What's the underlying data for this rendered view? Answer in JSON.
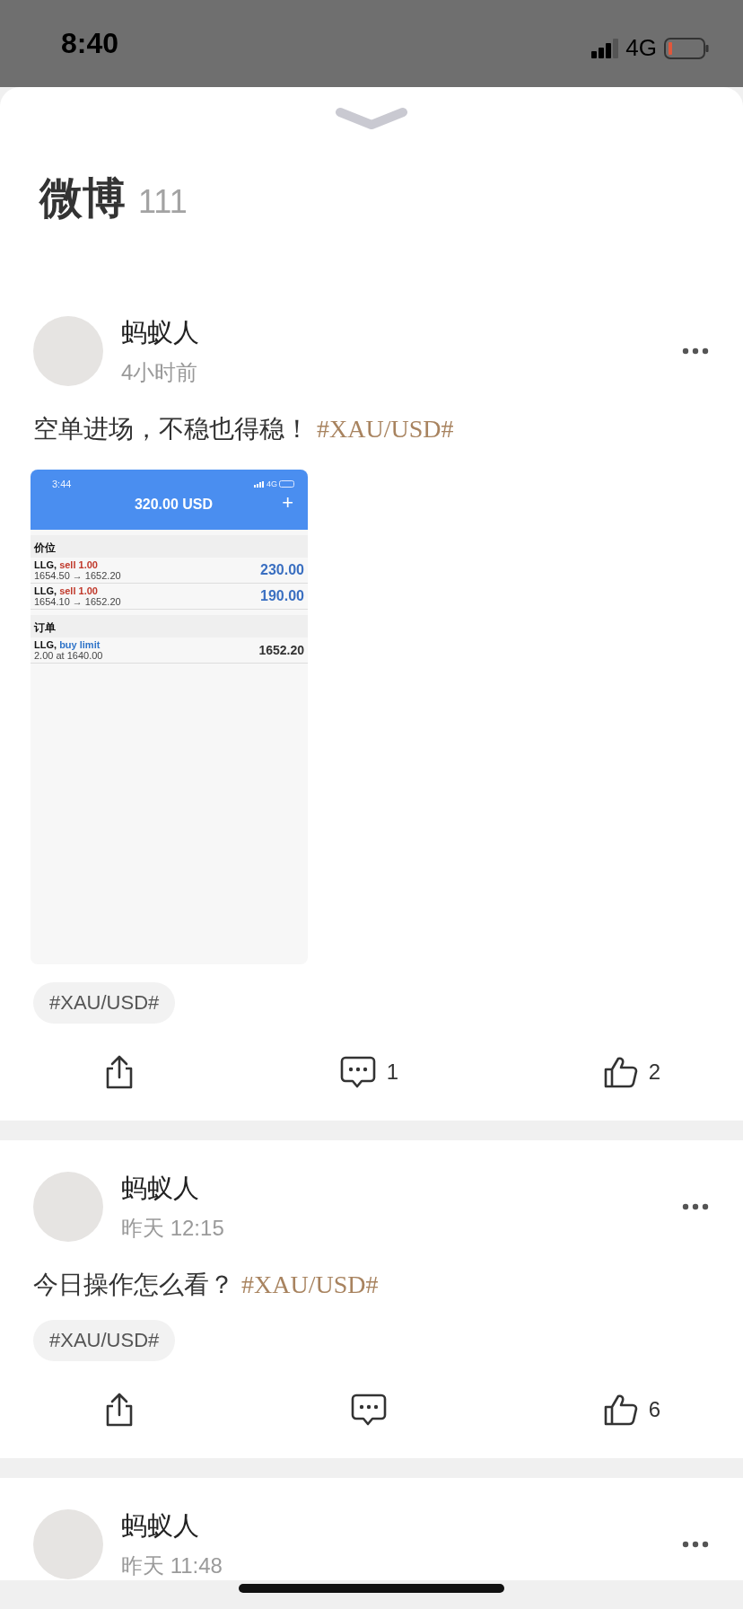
{
  "status_bar": {
    "time": "8:40",
    "network": "4G"
  },
  "sheet": {
    "title": "微博",
    "count": "111"
  },
  "posts": [
    {
      "author": "蚂蚁人",
      "time": "4小时前",
      "text": "空单进场，不稳也得稳！",
      "hashtag": "#XAU/USD#",
      "screenshot": {
        "time": "3:44",
        "network": "4G",
        "title": "320.00 USD",
        "action": "+",
        "sections": [
          {
            "heading": "价位",
            "rows": [
              {
                "kind": "position",
                "symbol": "LLG,",
                "color": "#c0392b",
                "order": "sell 1.00",
                "detail": "1654.50 → 1652.20",
                "value": "230.00"
              },
              {
                "kind": "position",
                "symbol": "LLG,",
                "color": "#c0392b",
                "order": "sell 1.00",
                "detail": "1654.10 → 1652.20",
                "value": "190.00"
              }
            ]
          },
          {
            "heading": "订单",
            "rows": [
              {
                "kind": "order",
                "symbol": "LLG,",
                "color": "#2f74c8",
                "order": "buy limit",
                "detail": "2.00 at 1640.00",
                "value": "1652.20"
              }
            ]
          }
        ]
      },
      "tags": [
        "#XAU/USD#"
      ],
      "actions": {
        "comments": "1",
        "likes": "2"
      }
    },
    {
      "author": "蚂蚁人",
      "time": "昨天 12:15",
      "text": "今日操作怎么看？",
      "hashtag": "#XAU/USD#",
      "tags": [
        "#XAU/USD#"
      ],
      "actions": {
        "likes": "6"
      }
    },
    {
      "author": "蚂蚁人",
      "time": "昨天 11:48"
    }
  ]
}
